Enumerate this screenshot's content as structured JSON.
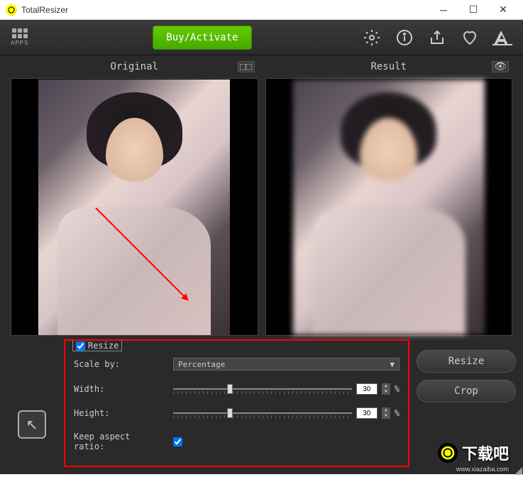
{
  "titlebar": {
    "title": "TotalResizer"
  },
  "toolbar": {
    "apps_label": "APPS",
    "activate_label": "Buy/Activate"
  },
  "panels": {
    "original": "Original",
    "result": "Result"
  },
  "resize_form": {
    "legend": "Resize",
    "scale_by_label": "Scale by:",
    "scale_by_value": "Percentage",
    "width_label": "Width:",
    "width_value": "30",
    "width_unit": "%",
    "height_label": "Height:",
    "height_value": "30",
    "height_unit": "%",
    "keep_ratio_label": "Keep aspect ratio:",
    "keep_ratio_checked": true
  },
  "actions": {
    "resize": "Resize",
    "crop": "Crop"
  },
  "watermark": {
    "text": "下载吧",
    "url": "www.xiazaiba.com"
  }
}
